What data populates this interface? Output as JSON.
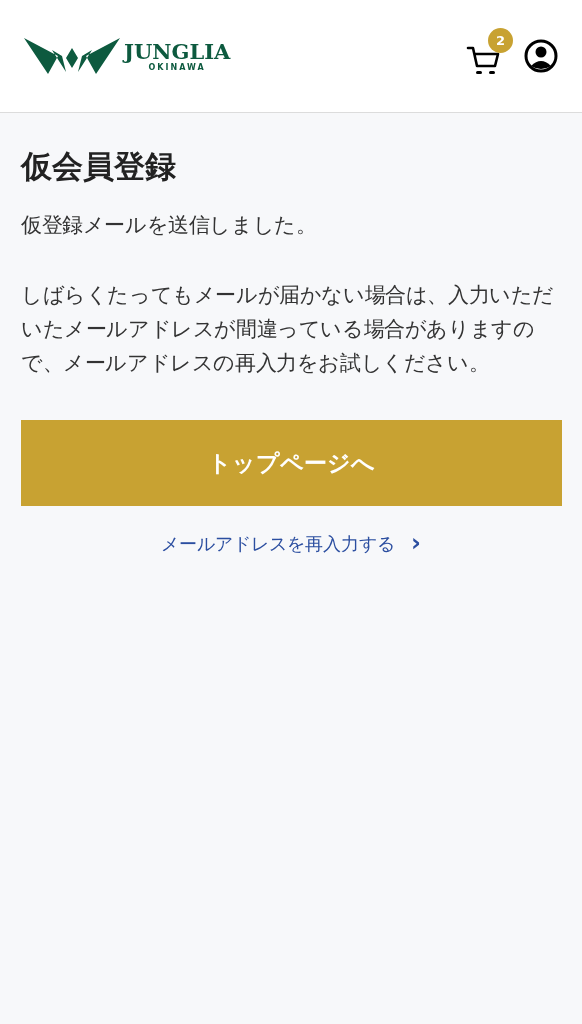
{
  "header": {
    "logo": {
      "name": "JUNGLIA",
      "sub": "OKINAWA"
    },
    "cart_count": "2"
  },
  "title": "仮会員登録",
  "paragraphs": [
    "仮登録メールを送信しました。",
    "しばらくたってもメールが届かない場合は、入力いただいたメールアドレスが間違っている場合がありますので、メールアドレスの再入力をお試しください。"
  ],
  "primary_button": "トップページへ",
  "link": {
    "label": "メールアドレスを再入力する",
    "arrow": "›"
  }
}
